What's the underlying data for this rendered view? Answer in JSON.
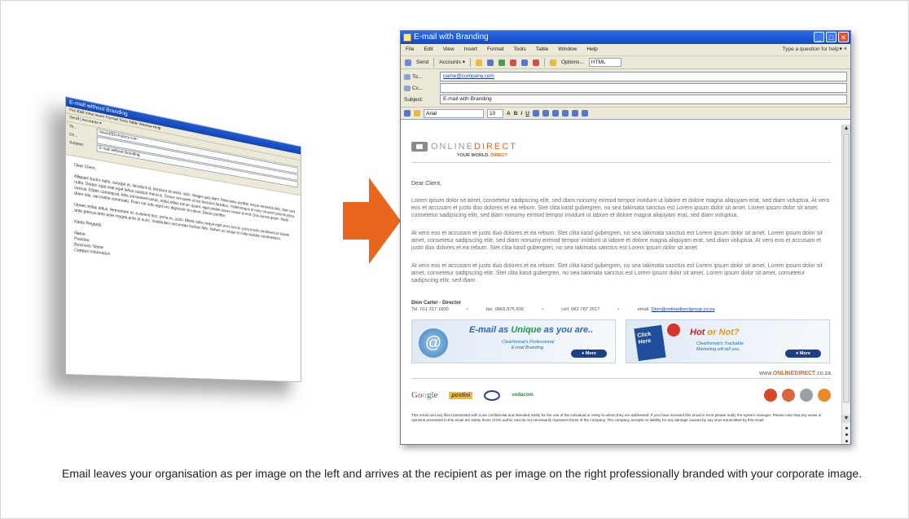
{
  "caption": "Email leaves your organisation as per image on the left and arrives at the recipient as per image on the right professionally branded with your corporate image.",
  "left_window": {
    "title": "E-mail without Branding",
    "menu": "File  Edit  View  Insert  Format  Tools  Table  Window  Help",
    "toolbar": "Send | Accounts ▾",
    "to_label": "To...",
    "to_value": "recent@company.com",
    "cc_label": "Cc...",
    "subject_label": "Subject:",
    "subject_value": "E-mail without Branding",
    "greeting": "Dear Client,",
    "para1": "Aliquam luctor nulla, suscipit et, tincidunt id, tincidunt sit amet, odio. Integer quis diam. Maecenas porttitor neque venenatis felis. Nam sed nulla. Donec eget erat eget tellus suscipit rhoncus. Donec vel quam et leo tincidunt faucibus. Pellentesque et tortor sit amet justo faucibus cursus. Etiam consequat, felis vel laoreet luctus, tellus tellus rutrum quam, eget ornare ipsum neque id erat. Duis lacinia ipsum. Morbi diam nisi, vel mattis commodo. Proin vel odio eget orci dignissim tincidunt. Donec porttitor.",
    "para2": "Donec tellus tellus, fermentum et, euismod nec, porta eu, justo. Morbi nulla; neque eget enim luctus, justo a odio condimentum blandit ante primus ante ante magna ante at nunc. Vestibulum accumsan facilisis felis. Nullam ac neque et nulla sodales condimentum.",
    "closing": "Kinds Regards",
    "sig_lines": [
      "Name",
      "Position",
      "Business Name",
      "Contact Information"
    ]
  },
  "right_window": {
    "title": "E-mail with Branding",
    "menu": [
      "File",
      "Edit",
      "View",
      "Insert",
      "Format",
      "Tools",
      "Table",
      "Window",
      "Help"
    ],
    "help_box": "Type a question for help",
    "help_x": "▾ ×",
    "toolbar": {
      "send": "Send",
      "accounts": "Accounts ▾",
      "options": "Options...",
      "format": "HTML"
    },
    "window_buttons": {
      "min": "_",
      "max": "□",
      "close": "✕"
    },
    "to_label": "To...",
    "to_value": "name@company.com",
    "cc_label": "Cc...",
    "cc_value": "",
    "subject_label": "Subject:",
    "subject_value": "E-mail with Branding",
    "font_value": "Arial",
    "size_value": "10",
    "format_buttons": [
      "A",
      "B",
      "I",
      "U"
    ],
    "scroll_up": "▲",
    "scroll_down": "▼"
  },
  "email": {
    "logo_word_1": "ONLINE",
    "logo_word_2": "DIRECT",
    "tagline_1": "YOUR WORLD.",
    "tagline_2": "DIRECT",
    "greeting": "Dear Client,",
    "para1": "Lorem ipsum dolor sit amet, consetetur sadipscing elitr,  sed diam nonumy eirmod tempor invidunt ut labore et dolore magna aliquyam erat, sed diam voluptua. At vero eos et accusam et justo duo dolores et ea rebum. Stet clita kasd gubergren, no sea takimata sanctus est Lorem ipsum dolor sit amet. Lorem ipsum dolor sit amet, consetetur sadipscing elitr,  sed diam nonumy eirmod tempor invidunt ut labore et dolore magna aliquyam erat, sed diam voluptua.",
    "para2": "At vero eos et accusam et justo duo dolores et ea rebum. Stet clita kasd gubergren, no sea takimata sanctus est Lorem ipsum dolor sit amet. Lorem ipsum dolor sit amet, consetetur sadipscing elitr,  sed diam nonumy eirmod tempor invidunt ut labore et dolore magna aliquyam erat, sed diam voluptua. At vero eos et accusam et justo duo dolores et ea rebum. Stet clita kasd gubergren, no sea takimata sanctus est Lorem ipsum dolor sit amet.",
    "para3": "At vero eos et accusam et justo duo dolores et ea rebum. Stet clita kasd gubergren, no sea takimata sanctus est Lorem ipsum dolor sit amet. Lorem ipsum dolor sit amet, consetetur sadipscing elitr,  Stet clita kasd gubergren, no sea takimata sanctus est Lorem ipsum dolor sit amet. Lorem ipsum dolor sit amet, consetetur sadipscing elitr,  sed diam .",
    "sig_name": "Dion Carter - Director",
    "sig_tel": "Tel. 011 317 1800",
    "sig_fax": "fax. 0866 875 836",
    "sig_cell": "cell. 082 787 2617",
    "sig_email_label": "email.",
    "sig_email": "Dion@onlinedirectgroup.co.za",
    "bullet": "•",
    "banner1_head_1": "E-mail as ",
    "banner1_head_2": "Unique",
    "banner1_head_3": " as you are..",
    "banner1_sub_1": "Clearformat's Professional",
    "banner1_sub_2": "E-mail Branding.",
    "banner1_at": "@",
    "banner2_head_1": "Hot",
    "banner2_head_2": " or Not?",
    "banner2_sub_1": "Clearformat's Trackable",
    "banner2_sub_2": "Marketing will tell you.",
    "banner2_click": "Click Here",
    "more_label": "● More",
    "url_1": "www.",
    "url_2": "ONLINEDIRECT",
    "url_3": ".co.za",
    "partner_google": [
      "G",
      "o",
      "o",
      "g",
      "l",
      "e"
    ],
    "partner_postini": "postini",
    "partner_vodacom": "vodacom",
    "disclaimer": "This email and any files transmitted with it are confidential and intended solely for the use of the individual or entity to whom they are addressed. If you have received this email in error please notify the system manager. Please note that any views or opinions presented in this email are solely those of the author and do not necessarily represent those of the company. The company accepts no liability for any damage caused by any virus transmitted by this email."
  },
  "colors": {
    "accent_orange": "#e8671c",
    "title_blue": "#1f5bd6"
  }
}
